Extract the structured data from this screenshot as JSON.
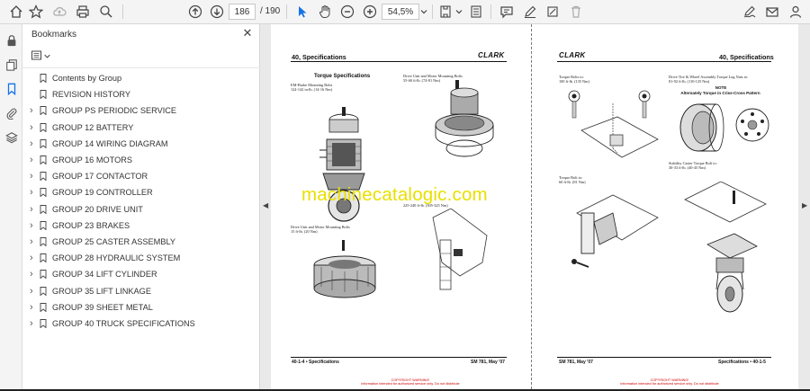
{
  "toolbar": {
    "page_current": "186",
    "page_total": "/ 190",
    "zoom": "54,5%"
  },
  "panel": {
    "title": "Bookmarks",
    "close_glyph": "✕"
  },
  "bookmarks": [
    {
      "label": "Contents by Group",
      "expandable": false
    },
    {
      "label": "REVISION HISTORY",
      "expandable": false
    },
    {
      "label": "GROUP PS  PERIODIC SERVICE",
      "expandable": true
    },
    {
      "label": "GROUP 12   BATTERY",
      "expandable": true
    },
    {
      "label": "GROUP 14   WIRING DIAGRAM",
      "expandable": true
    },
    {
      "label": "GROUP 16   MOTORS",
      "expandable": true
    },
    {
      "label": "GROUP 17   CONTACTOR",
      "expandable": true
    },
    {
      "label": "GROUP 19   CONTROLLER",
      "expandable": true
    },
    {
      "label": "GROUP 20   DRIVE UNIT",
      "expandable": true
    },
    {
      "label": "GROUP 23   BRAKES",
      "expandable": true
    },
    {
      "label": "GROUP 25   CASTER ASSEMBLY",
      "expandable": true
    },
    {
      "label": "GROUP 28   HYDRAULIC SYSTEM",
      "expandable": true
    },
    {
      "label": "GROUP 34   LIFT CYLINDER",
      "expandable": true
    },
    {
      "label": "GROUP 35   LIFT LINKAGE",
      "expandable": true
    },
    {
      "label": "GROUP 39   SHEET METAL",
      "expandable": true
    },
    {
      "label": "GROUP 40   TRUCK SPECIFICATIONS",
      "expandable": true
    }
  ],
  "left_page": {
    "header": "40, Specifications",
    "logo": "CLARK",
    "section_title": "Torque Specifications",
    "cap_brake": "EM-Brake Mounting Bolts\n124-142 in-lb. (14-16 Nm)",
    "cap_drive_top": "Drive Unit and Motor Mounting Bolts\n55-60 ft-lb. (74-81 Nm)",
    "cap_drive_mid": "Drive Unit and Motor Mounting Bolts\n15 ft-lb. (20 Nm)",
    "cap_225": "225-240 ft-lb. (305-325 Nm)",
    "footer_left": "40-1-4 • Specifications",
    "footer_right": "SM 781, May '07"
  },
  "right_page": {
    "header": "40, Specifications",
    "logo": "CLARK",
    "cap_torque_top": "Torque Bolts to:\n100 ft-lb. (135 Nm)",
    "cap_tire": "Drive Tire & Wheel Assembly Torque Lug Nuts to:\n81-92 ft-lb. (110-125 Nm)",
    "note_title": "NOTE",
    "note_text": "Alternately Torque in Criss-Cross Pattern",
    "cap_torque_60": "Torque Bolt to:\n60 ft-lb. (81 Nm)",
    "cap_stability": "Stability Caster Torque Bolt to:\n30-33 ft-lb. (40-45 Nm)",
    "footer_left": "SM 781, May '07",
    "footer_right": "Specifications • 40-1-5"
  },
  "copyright": "COPYRIGHT WARNING!\ninformation intended for authorized service only. Do not distribute",
  "watermark": "machinecatalogic.com",
  "colors": {
    "accent": "#1473e6",
    "watermark": "#e8e000",
    "copyright": "#cc0000"
  }
}
